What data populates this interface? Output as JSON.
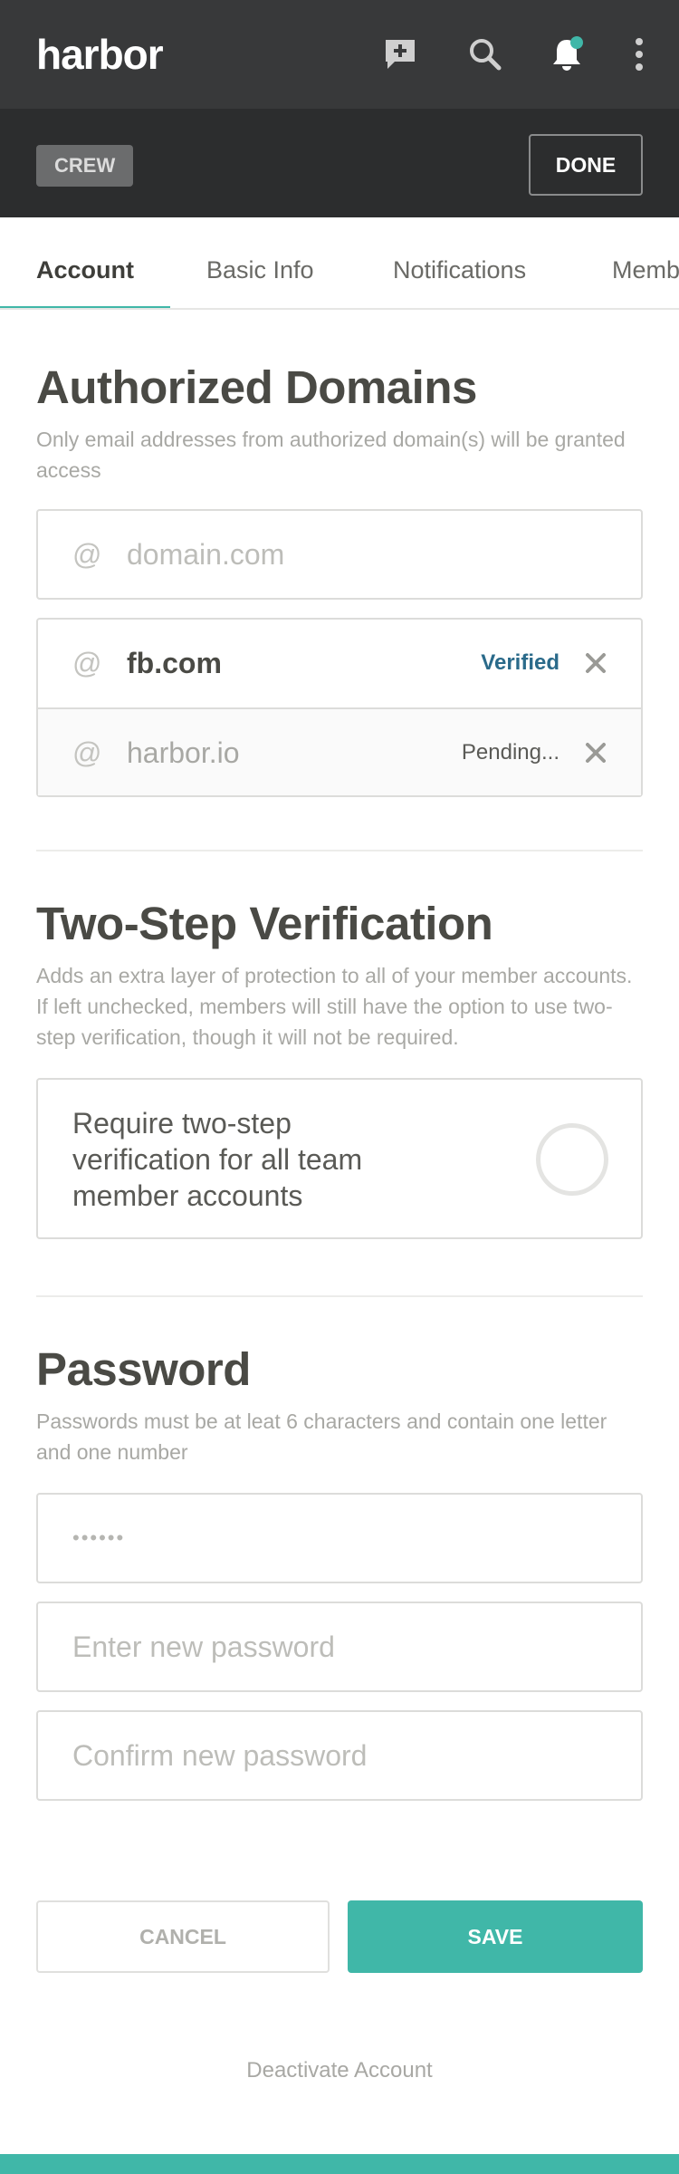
{
  "app": {
    "logo": "harbor"
  },
  "topbar": {
    "icons": [
      "message-plus-icon",
      "search-icon",
      "bell-icon",
      "more-vertical-icon"
    ],
    "notification_dot_color": "#40b7a8"
  },
  "subbar": {
    "team_chip": "CREW",
    "done_label": "DONE"
  },
  "tabs": [
    {
      "label": "Account",
      "active": true
    },
    {
      "label": "Basic Info",
      "active": false
    },
    {
      "label": "Notifications",
      "active": false
    },
    {
      "label": "Members",
      "active": false
    }
  ],
  "domains": {
    "title": "Authorized Domains",
    "description": "Only email addresses from authorized domain(s) will be granted access",
    "at_symbol": "@",
    "input_placeholder": "domain.com",
    "items": [
      {
        "domain": "fb.com",
        "status": "Verified"
      },
      {
        "domain": "harbor.io",
        "status": "Pending..."
      }
    ]
  },
  "two_step": {
    "title": "Two-Step Verification",
    "description": "Adds an extra layer of protection to all of your member accounts. If left unchecked, members will still have the option to use two-step verification, though it will not be required.",
    "toggle_label": "Require two-step verification for all team member accounts",
    "enabled": false
  },
  "password": {
    "title": "Password",
    "description": "Passwords must be at leat 6 characters and contain one letter and one number",
    "current_value": "••••••",
    "new_placeholder": "Enter new password",
    "confirm_placeholder": "Confirm new password"
  },
  "actions": {
    "cancel_label": "CANCEL",
    "save_label": "SAVE",
    "deactivate_label": "Deactivate Account"
  },
  "colors": {
    "accent": "#40b7a8",
    "topbar": "#38393a",
    "subbar": "#2c2d2e",
    "verified": "#2a6a8a"
  }
}
